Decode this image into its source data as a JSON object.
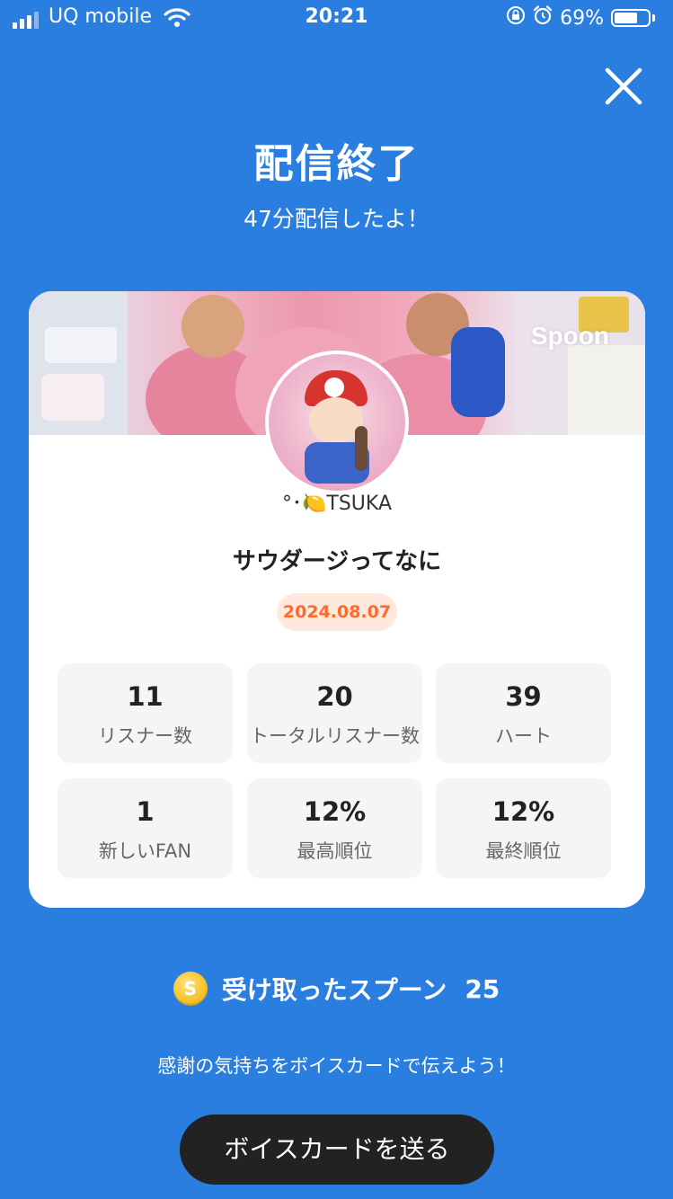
{
  "status_bar": {
    "carrier": "UQ mobile",
    "time": "20:21",
    "battery": "69%",
    "battery_level": 0.69
  },
  "header": {
    "title": "配信終了",
    "subtitle": "47分配信したよ！"
  },
  "card": {
    "brand": "Spoon",
    "username": "°･🍋TSUKA",
    "stream_title": "サウダージってなに",
    "date": "2024.08.07",
    "stats": [
      {
        "value": "11",
        "label": "リスナー数"
      },
      {
        "value": "20",
        "label": "トータルリスナー数"
      },
      {
        "value": "39",
        "label": "ハート"
      },
      {
        "value": "1",
        "label": "新しいFAN"
      },
      {
        "value": "12%",
        "label": "最高順位"
      },
      {
        "value": "12%",
        "label": "最終順位"
      }
    ]
  },
  "spoons": {
    "coin_symbol": "S",
    "label": "受け取ったスプーン",
    "count": "25"
  },
  "thanks_text": "感謝の気持ちをボイスカードで伝えよう！",
  "voice_card_button": "ボイスカードを送る",
  "colors": {
    "background": "#2a7ee0",
    "date_badge_text": "#ff6a2b",
    "date_badge_bg": "#ffe9df",
    "button_bg": "#222222"
  }
}
